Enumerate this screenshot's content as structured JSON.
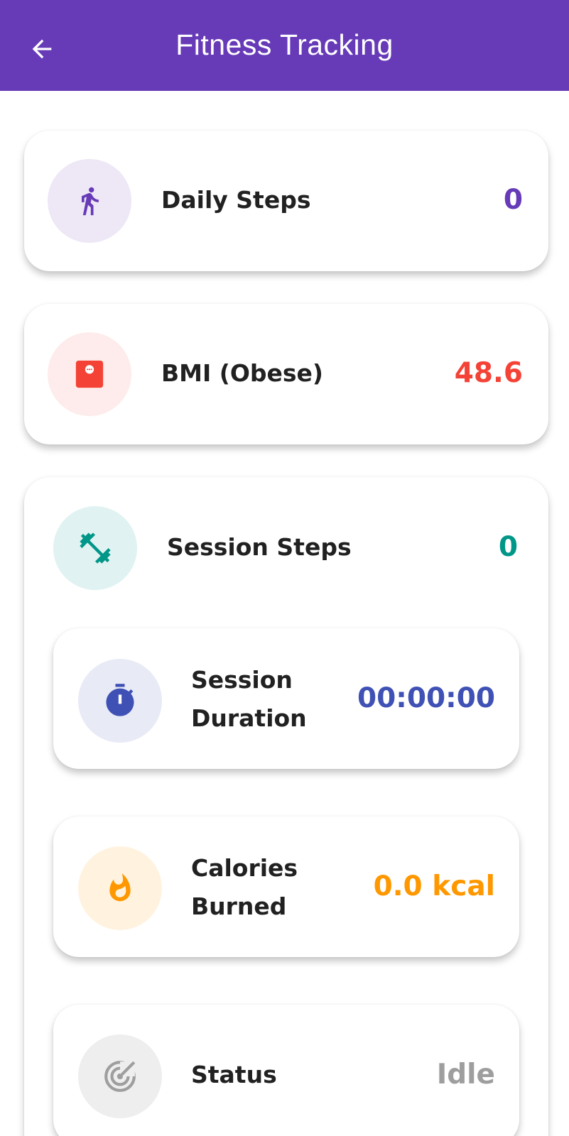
{
  "app_bar": {
    "title": "Fitness Tracking",
    "back_icon": "arrow-left-icon",
    "color": "#673ab7"
  },
  "cards": {
    "daily_steps": {
      "label": "Daily Steps",
      "value": "0",
      "icon": "walk-icon",
      "color": "#673ab7",
      "icon_bg": "#ede7f6"
    },
    "bmi": {
      "label": "BMI (Obese)",
      "value": "48.6",
      "icon": "scale-icon",
      "color": "#f44336",
      "icon_bg": "#fdeceb"
    },
    "session_steps": {
      "label": "Session Steps",
      "value": "0",
      "icon": "dumbbell-icon",
      "color": "#009688",
      "icon_bg": "#e0f2f1"
    },
    "session_duration": {
      "label_line1": "Session",
      "label_line2": "Duration",
      "value": "00:00:00",
      "icon": "stopwatch-icon",
      "color": "#3f51b5",
      "icon_bg": "#e8eaf6"
    },
    "calories": {
      "label_line1": "Calories",
      "label_line2": "Burned",
      "value": "0.0 kcal",
      "icon": "fire-icon",
      "color": "#ff9800",
      "icon_bg": "#fff3e0"
    },
    "status": {
      "label": "Status",
      "value": "Idle",
      "icon": "radar-icon",
      "color": "#9e9e9e",
      "icon_bg": "#eeeeee"
    }
  }
}
